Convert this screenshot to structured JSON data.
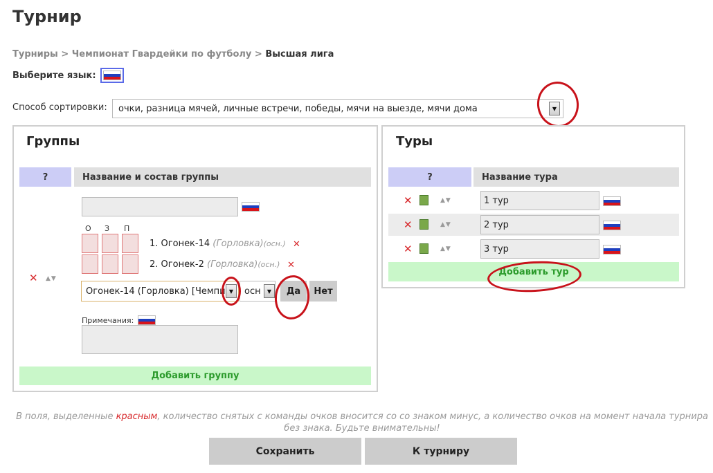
{
  "page": {
    "title": "Турнир"
  },
  "breadcrumb": {
    "items": [
      "Турниры",
      "Чемпионат Гвардейки по футболу"
    ],
    "separator": ">",
    "current": "Высшая лига"
  },
  "language": {
    "label": "Выберите язык:",
    "selected_flag": "flag-ru-icon"
  },
  "sort": {
    "label": "Способ сортировки:",
    "value": "очки, разница мячей, личные встречи, победы, мячи на выезде, мячи дома"
  },
  "groups": {
    "title": "Группы",
    "header_q": "?",
    "header_name": "Название и состав группы",
    "group_name_value": "",
    "points_headers": [
      "О",
      "З",
      "П"
    ],
    "teams": [
      {
        "num": "1.",
        "name": "Огонек-14",
        "city": "(Горловка)",
        "basis": "(осн.)"
      },
      {
        "num": "2.",
        "name": "Огонек-2",
        "city": "(Горловка)",
        "basis": "(осн.)"
      }
    ],
    "team_select_value": "Огонек-14 (Горловка) [Чемпи",
    "basis_select_value": "осн",
    "yes_label": "Да",
    "no_label": "Нет",
    "notes_label": "Примечания:",
    "add_label": "Добавить группу"
  },
  "tours": {
    "title": "Туры",
    "header_q": "?",
    "header_name": "Название тура",
    "rows": [
      {
        "name": "1 тур"
      },
      {
        "name": "2 тур"
      },
      {
        "name": "3 тур"
      }
    ],
    "add_label": "Добавить тур"
  },
  "footer": {
    "note_before": "В поля, выделенные ",
    "note_red": "красным",
    "note_after": ", количество снятых с команды очков вносится со со знаком минус, а количество очков на момент начала турнира без знака. Будьте внимательны!",
    "save_label": "Сохранить",
    "back_label": "К турниру"
  },
  "colors": {
    "accent_blue_header": "#cccdf6",
    "add_green_bg": "#c9f7c9",
    "add_green_text": "#2c9b2c",
    "delete_red": "#d7282b",
    "annotation_red": "#c8121a"
  }
}
